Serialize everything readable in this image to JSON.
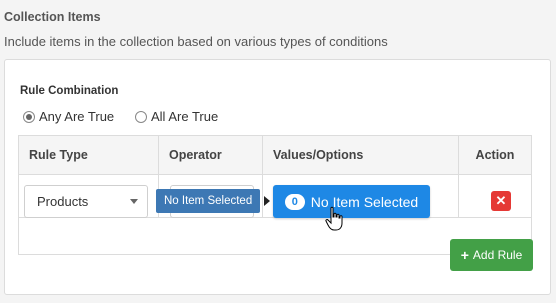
{
  "section": {
    "title": "Collection Items",
    "description": "Include items in the collection based on various types of conditions"
  },
  "rule_combination": {
    "label": "Rule Combination",
    "options": [
      {
        "label": "Any Are True",
        "selected": true
      },
      {
        "label": "All Are True",
        "selected": false
      }
    ]
  },
  "table": {
    "columns": [
      "Rule Type",
      "Operator",
      "Values/Options",
      "Action"
    ],
    "rows": [
      {
        "rule_type": "Products",
        "operator": "",
        "values_button": {
          "count": "0",
          "label": "No Item Selected"
        },
        "tooltip": "No Item Selected"
      }
    ]
  },
  "add_rule": {
    "label": "Add Rule",
    "icon": "plus-icon"
  },
  "colors": {
    "primary": "#1e88e5",
    "danger": "#e53935",
    "success": "#43a047",
    "tooltip": "#3d78b4"
  }
}
